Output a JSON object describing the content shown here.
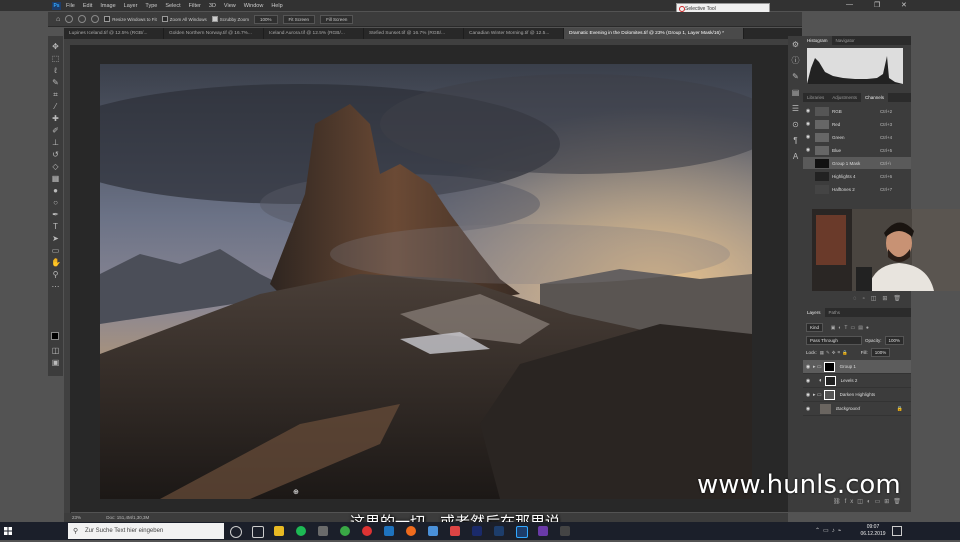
{
  "menu": {
    "items": [
      "File",
      "Edit",
      "Image",
      "Layer",
      "Type",
      "Select",
      "Filter",
      "3D",
      "View",
      "Window",
      "Help"
    ],
    "search_placeholder": "Selective Tool"
  },
  "options_bar": {
    "resize_windows": "Resize Windows to Fit",
    "zoom_all_windows": "Zoom All Windows",
    "scrubby_zoom": "Scrubby Zoom",
    "zoom_percent": "100%",
    "fit_screen": "Fit Screen",
    "fill_screen": "Fill Screen"
  },
  "tabs": [
    {
      "label": "Lupines Iceland.tif @ 12.5% (RGB/..."
    },
    {
      "label": "Golden Northern Norway.tif @ 16.7%..."
    },
    {
      "label": "Iceland Aurora.tif @ 12.5% (RGB/..."
    },
    {
      "label": "Stefied Sunset.tif @ 16.7% (RGB/..."
    },
    {
      "label": "Canadian Winter Morning.tif @ 12.5..."
    },
    {
      "label": "Dramatic Evening in the Dolomites.tif @ 23% (Group 1, Layer Mask/16) *"
    }
  ],
  "status": {
    "zoom": "23%",
    "doc": "Doc: 151,4M/1,30,3M"
  },
  "panels": {
    "histogram_tabs": [
      "Histogram",
      "Navigator"
    ],
    "channel_tabs": [
      "Libraries",
      "Adjustments",
      "Channels"
    ],
    "channels": [
      {
        "name": "RGB",
        "shortcut": "Ctrl+2"
      },
      {
        "name": "Red",
        "shortcut": "Ctrl+3"
      },
      {
        "name": "Green",
        "shortcut": "Ctrl+4"
      },
      {
        "name": "Blue",
        "shortcut": "Ctrl+5"
      },
      {
        "name": "Group 1 Mask",
        "shortcut": "Ctrl+\\"
      },
      {
        "name": "Highlights 4",
        "shortcut": "Ctrl+6"
      },
      {
        "name": "Halftones 2",
        "shortcut": "Ctrl+7"
      }
    ],
    "layer_tabs": [
      "Layers",
      "Paths"
    ],
    "kind": "Kind",
    "blend_mode": "Pass Through",
    "opacity_label": "Opacity:",
    "opacity": "100%",
    "lock_label": "Lock:",
    "fill_label": "Fill:",
    "fill": "100%",
    "layers": [
      {
        "name": "Group 1"
      },
      {
        "name": "Levels 2"
      },
      {
        "name": "Darken Highlights"
      },
      {
        "name": "Background"
      }
    ]
  },
  "watermark": "www.hunls.com",
  "subtitle": "这里的一切，或者然后在那里说",
  "taskbar": {
    "search_placeholder": "Zur Suche Text hier eingeben",
    "time": "09:07",
    "date": "06.12.2019"
  }
}
